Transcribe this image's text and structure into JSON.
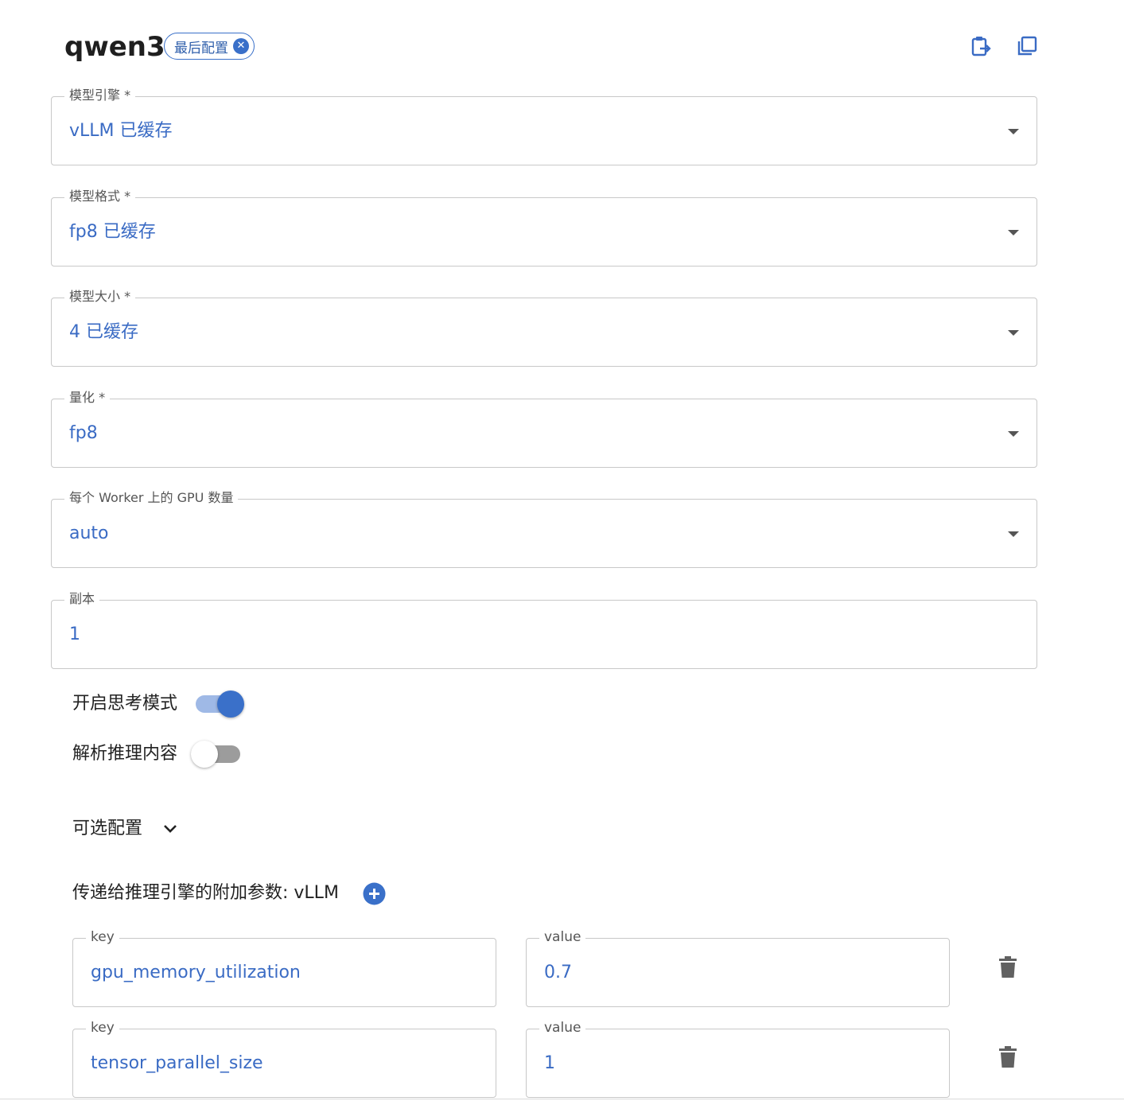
{
  "header": {
    "title": "qwen3",
    "chip_label": "最后配置",
    "icons": [
      "clipboard-paste-icon",
      "copy-icon"
    ]
  },
  "fields": [
    {
      "label": "模型引擎 *",
      "value": "vLLM 已缓存"
    },
    {
      "label": "模型格式 *",
      "value": "fp8 已缓存"
    },
    {
      "label": "模型大小 *",
      "value": "4 已缓存"
    },
    {
      "label": "量化 *",
      "value": "fp8"
    },
    {
      "label": "每个 Worker 上的 GPU 数量",
      "value": "auto"
    },
    {
      "label": "副本",
      "value": "1"
    }
  ],
  "toggles": [
    {
      "label": "开启思考模式",
      "on": true
    },
    {
      "label": "解析推理内容",
      "on": false
    }
  ],
  "optional": {
    "label": "可选配置"
  },
  "extra": {
    "label": "传递给推理引擎的附加参数: vLLM",
    "key_label": "key",
    "value_label": "value",
    "rows": [
      {
        "key": "gpu_memory_utilization",
        "value": "0.7"
      },
      {
        "key": "tensor_parallel_size",
        "value": "1"
      }
    ]
  },
  "colors": {
    "accent": "#3a70c9",
    "value_text": "#3a6bc4",
    "border": "#c8c8c8"
  }
}
